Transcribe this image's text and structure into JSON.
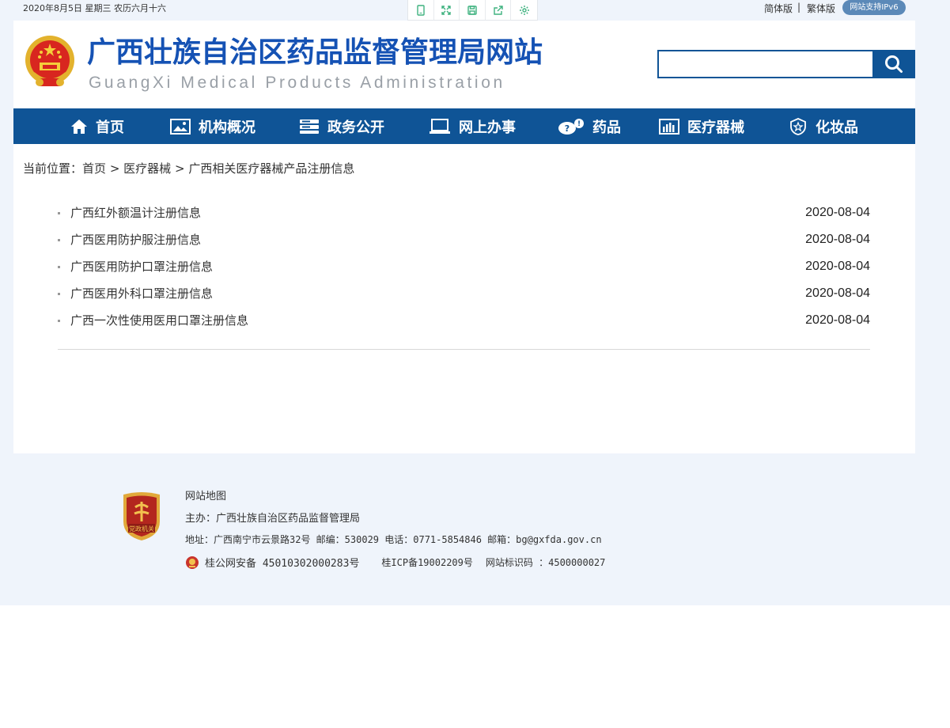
{
  "topbar": {
    "date_text": "2020年8月5日 星期三 农历六月十六",
    "lang_simplified": "简体版",
    "lang_separator": "|",
    "lang_traditional": "繁体版",
    "ipv6_badge": "网站支持IPv6",
    "tools": [
      "mobile-icon",
      "fullscreen-icon",
      "save-icon",
      "share-icon",
      "settings-icon"
    ]
  },
  "header": {
    "title": "广西壮族自治区药品监督管理局网站",
    "subtitle": "GuangXi Medical Products Administration",
    "search_placeholder": ""
  },
  "nav": {
    "items": [
      {
        "label": "首页",
        "icon": "home-icon"
      },
      {
        "label": "机构概况",
        "icon": "image-icon"
      },
      {
        "label": "政务公开",
        "icon": "server-icon"
      },
      {
        "label": "网上办事",
        "icon": "monitor-icon"
      },
      {
        "label": "药品",
        "icon": "pills-icon"
      },
      {
        "label": "医疗器械",
        "icon": "bar-chart-icon"
      },
      {
        "label": "化妆品",
        "icon": "shield-icon"
      }
    ]
  },
  "breadcrumb": {
    "prefix": "当前位置：",
    "items": [
      "首页",
      "医疗器械",
      "广西相关医疗器械产品注册信息"
    ],
    "separator": ">"
  },
  "articles": [
    {
      "title": "广西红外额温计注册信息",
      "date": "2020-08-04"
    },
    {
      "title": "广西医用防护服注册信息",
      "date": "2020-08-04"
    },
    {
      "title": "广西医用防护口罩注册信息",
      "date": "2020-08-04"
    },
    {
      "title": "广西医用外科口罩注册信息",
      "date": "2020-08-04"
    },
    {
      "title": "广西一次性使用医用口罩注册信息",
      "date": "2020-08-04"
    }
  ],
  "footer": {
    "sitemap": "网站地图",
    "sponsor": "主办：广西壮族自治区药品监督管理局",
    "address": "地址：广西南宁市云景路32号 邮编：530029 电话：0771-5854846 邮箱：bg@gxfda.gov.cn",
    "police_record": "桂公网安备 45010302000283号",
    "icp_record": "桂ICP备19002209号",
    "site_id": "网站标识码 ：4500000027",
    "badge_text": "党政机关"
  },
  "colors": {
    "brand_blue": "#0f5496",
    "title_blue": "#1552b4",
    "page_bg": "#eff4fb",
    "badge_red": "#b3261e"
  }
}
